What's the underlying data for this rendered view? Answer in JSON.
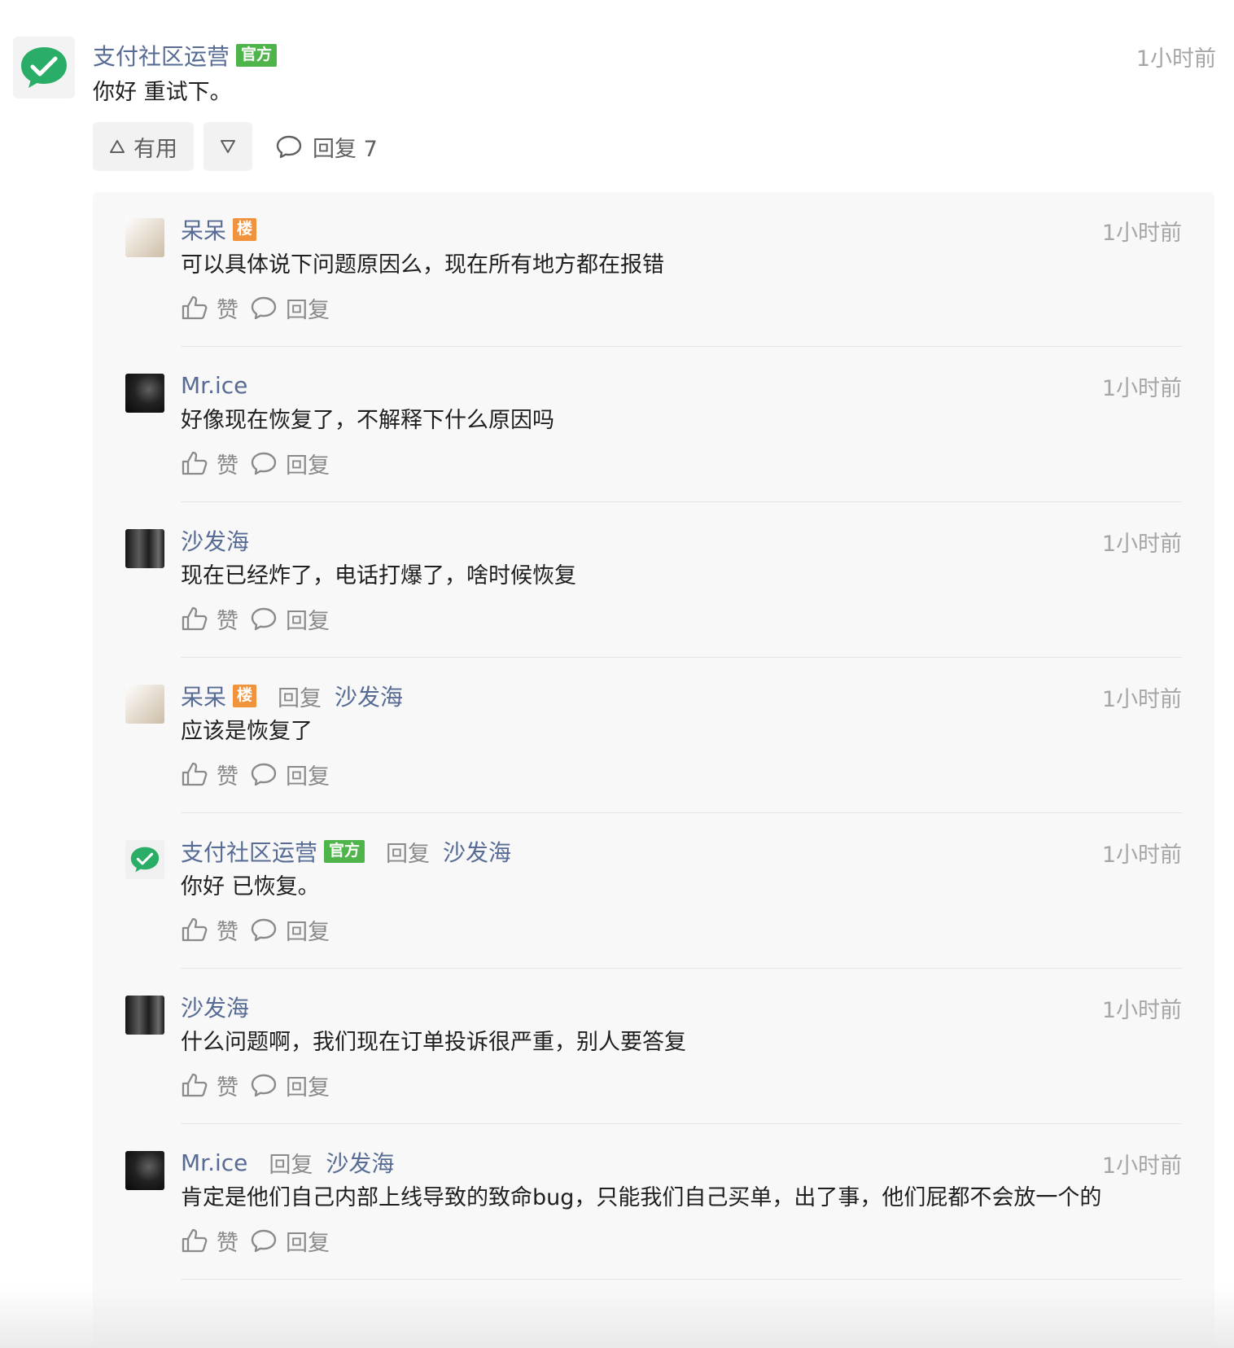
{
  "post": {
    "author": "支付社区运营",
    "badge": "官方",
    "time": "1小时前",
    "text": "你好 重试下。",
    "useful_label": "有用",
    "reply_label": "回复 7"
  },
  "replies": [
    {
      "author": "呆呆",
      "badge": "楼",
      "verb": "",
      "target": "",
      "time": "1小时前",
      "text": "可以具体说下问题原因么，现在所有地方都在报错",
      "like": "赞",
      "reply": "回复"
    },
    {
      "author": "Mr.ice",
      "badge": "",
      "verb": "",
      "target": "",
      "time": "1小时前",
      "text": "好像现在恢复了，不解释下什么原因吗",
      "like": "赞",
      "reply": "回复"
    },
    {
      "author": "沙发海",
      "badge": "",
      "verb": "",
      "target": "",
      "time": "1小时前",
      "text": "现在已经炸了，电话打爆了，啥时候恢复",
      "like": "赞",
      "reply": "回复"
    },
    {
      "author": "呆呆",
      "badge": "楼",
      "verb": "回复",
      "target": "沙发海",
      "time": "1小时前",
      "text": "应该是恢复了",
      "like": "赞",
      "reply": "回复"
    },
    {
      "author": "支付社区运营",
      "badge": "官方",
      "verb": "回复",
      "target": "沙发海",
      "time": "1小时前",
      "text": "你好 已恢复。",
      "like": "赞",
      "reply": "回复"
    },
    {
      "author": "沙发海",
      "badge": "",
      "verb": "",
      "target": "",
      "time": "1小时前",
      "text": "什么问题啊，我们现在订单投诉很严重，别人要答复",
      "like": "赞",
      "reply": "回复"
    },
    {
      "author": "Mr.ice",
      "badge": "",
      "verb": "回复",
      "target": "沙发海",
      "time": "1小时前",
      "text": "肯定是他们自己内部上线导致的致命bug，只能我们自己买单，出了事，他们屁都不会放一个的",
      "like": "赞",
      "reply": "回复"
    }
  ],
  "colors": {
    "link": "#576b95",
    "official": "#4fb44a",
    "floor": "#f1933d",
    "muted": "#a6a6a6"
  },
  "icons": [
    "wechat-logo-icon",
    "triangle-up-icon",
    "triangle-down-icon",
    "comment-icon",
    "thumbs-up-icon"
  ]
}
